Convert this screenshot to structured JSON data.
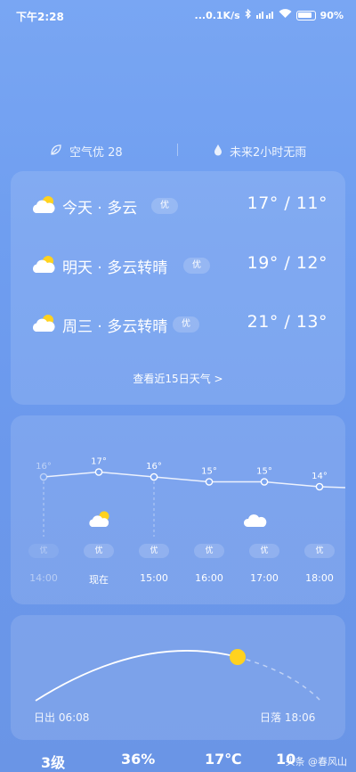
{
  "status_bar": {
    "time": "下午2:28",
    "network_speed": "...0.1K/s",
    "battery": "90%"
  },
  "air_row": {
    "air_quality": "空气优 28",
    "rain": "未来2小时无雨"
  },
  "forecast": {
    "days": [
      {
        "label": "今天 · 多云",
        "aqi": "优",
        "temp": "17° / 11°",
        "icon": "cloudy-icon"
      },
      {
        "label": "明天 · 多云转晴",
        "aqi": "优",
        "temp": "19° / 12°",
        "icon": "partly-sunny-icon"
      },
      {
        "label": "周三 · 多云转晴",
        "aqi": "优",
        "temp": "21° / 13°",
        "icon": "partly-sunny-icon"
      }
    ],
    "more_link": "查看近15日天气 >"
  },
  "hourly": {
    "temps": [
      "16°",
      "17°",
      "16°",
      "15°",
      "15°",
      "14°"
    ],
    "temp_values": [
      16,
      17,
      16,
      15,
      15,
      14
    ],
    "aqi": [
      "优",
      "优",
      "优",
      "优",
      "优",
      "优"
    ],
    "times": [
      "14:00",
      "现在",
      "15:00",
      "16:00",
      "17:00",
      "18:00"
    ]
  },
  "sun": {
    "sunrise": "日出 06:08",
    "sunset": "日落 18:06"
  },
  "stats": {
    "wind": "3级",
    "humidity": "36%",
    "feels_like": "17℃",
    "partial": "10"
  },
  "watermark": "头条 @春风山",
  "colors": {
    "sun": "#ffd21f",
    "background": "#6f9ef0"
  }
}
